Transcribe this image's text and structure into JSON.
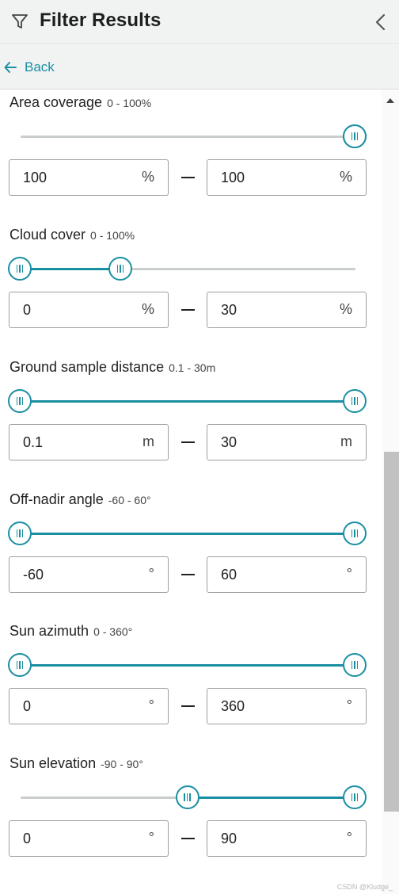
{
  "header": {
    "title": "Filter Results",
    "filter_icon": "filter-icon",
    "collapse_icon": "chevron-left-icon"
  },
  "nav": {
    "back_label": "Back"
  },
  "colors": {
    "accent": "#1a8fa3",
    "track": "#c9cdce",
    "header_bg": "#f1f3f3"
  },
  "filters": [
    {
      "label": "Area coverage",
      "range": "0 - 100%",
      "min_value": "100",
      "max_value": "100",
      "unit": "%",
      "low_fraction": 1.0,
      "high_fraction": 1.0
    },
    {
      "label": "Cloud cover",
      "range": "0 - 100%",
      "min_value": "0",
      "max_value": "30",
      "unit": "%",
      "low_fraction": 0.0,
      "high_fraction": 0.3
    },
    {
      "label": "Ground sample distance",
      "range": "0.1 - 30m",
      "min_value": "0.1",
      "max_value": "30",
      "unit": "m",
      "low_fraction": 0.0,
      "high_fraction": 1.0
    },
    {
      "label": "Off-nadir angle",
      "range": "-60 - 60°",
      "min_value": "-60",
      "max_value": "60",
      "unit": "°",
      "low_fraction": 0.0,
      "high_fraction": 1.0
    },
    {
      "label": "Sun azimuth",
      "range": "0 - 360°",
      "min_value": "0",
      "max_value": "360",
      "unit": "°",
      "low_fraction": 0.0,
      "high_fraction": 1.0
    },
    {
      "label": "Sun elevation",
      "range": "-90 - 90°",
      "min_value": "0",
      "max_value": "90",
      "unit": "°",
      "low_fraction": 0.5,
      "high_fraction": 1.0
    }
  ],
  "watermark": "CSDN @Kludge_"
}
